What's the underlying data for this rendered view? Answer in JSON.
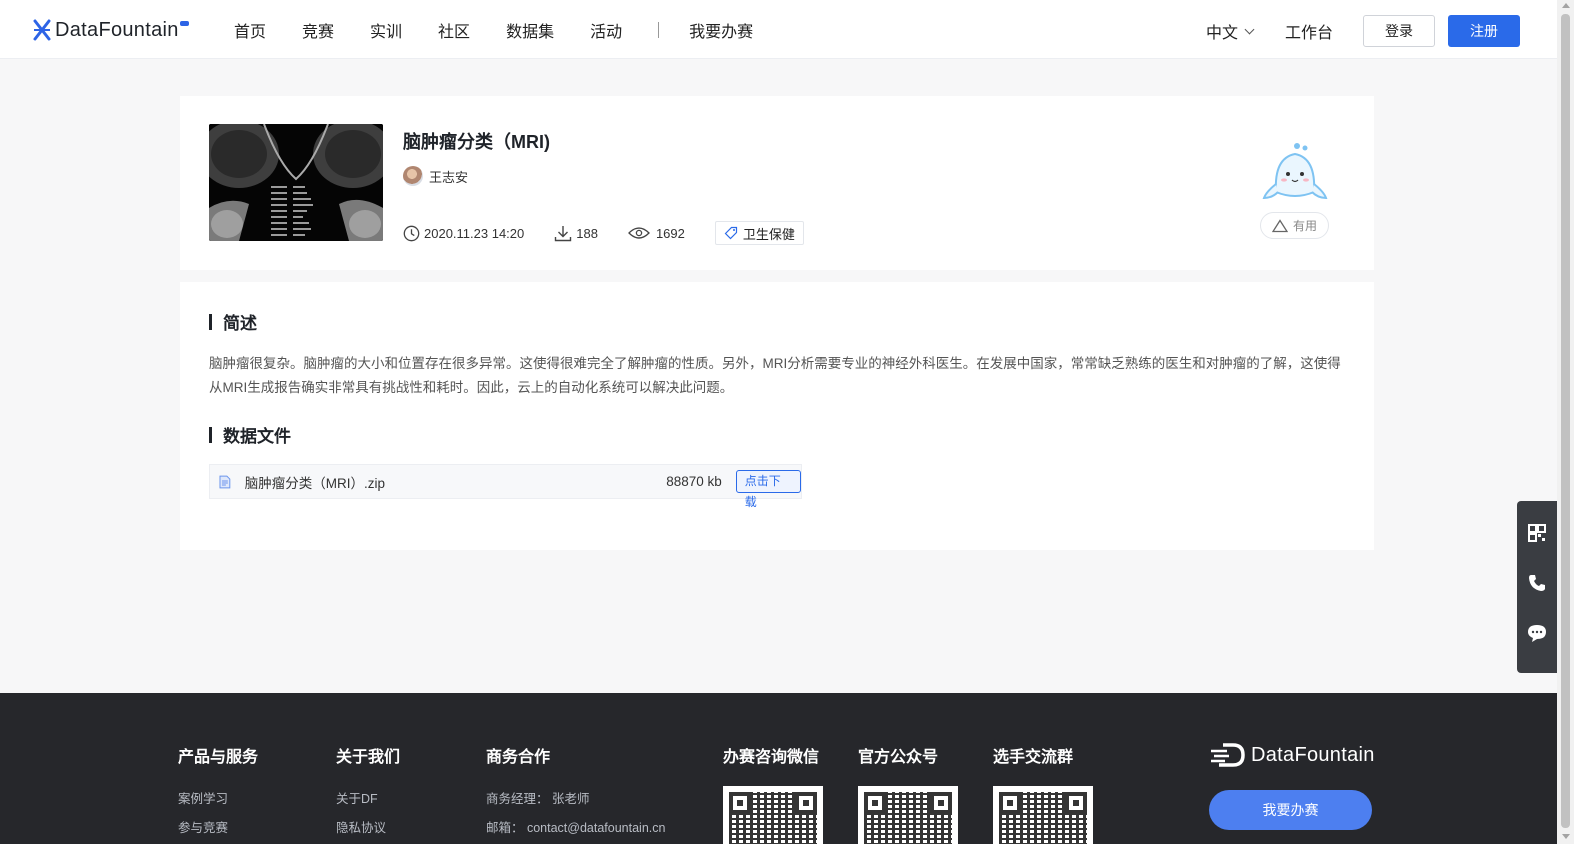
{
  "header": {
    "logo_text": "DataFountain",
    "nav": [
      "首页",
      "竞赛",
      "实训",
      "社区",
      "数据集",
      "活动"
    ],
    "nav_extra": "我要办赛",
    "language": "中文",
    "workbench": "工作台",
    "login": "登录",
    "register": "注册"
  },
  "dataset": {
    "title": "脑肿瘤分类（MRI)",
    "author": "王志安",
    "datetime": "2020.11.23 14:20",
    "downloads": "188",
    "views": "1692",
    "tag": "卫生保健",
    "useful_label": "有用"
  },
  "overview": {
    "title": "简述",
    "text": "脑肿瘤很复杂。脑肿瘤的大小和位置存在很多异常。这使得很难完全了解肿瘤的性质。另外，MRI分析需要专业的神经外科医生。在发展中国家，常常缺乏熟练的医生和对肿瘤的了解，这使得从MRI生成报告确实非常具有挑战性和耗时。因此，云上的自动化系统可以解决此问题。"
  },
  "files": {
    "title": "数据文件",
    "items": [
      {
        "name": "脑肿瘤分类（MRI）.zip",
        "size": "88870 kb",
        "action": "点击下载"
      }
    ]
  },
  "footer": {
    "products": {
      "title": "产品与服务",
      "links": [
        "案例学习",
        "参与竞赛"
      ]
    },
    "about": {
      "title": "关于我们",
      "links": [
        "关于DF",
        "隐私协议"
      ]
    },
    "business": {
      "title": "商务合作",
      "manager": "商务经理： 张老师",
      "email": "邮箱： contact@datafountain.cn"
    },
    "qr_wechat": "办赛咨询微信",
    "qr_official": "官方公众号",
    "qr_group": "选手交流群",
    "logo_text": "DataFountain",
    "cta": "我要办赛"
  },
  "colors": {
    "brand_blue": "#2a6ae9",
    "footer_bg": "#26272b",
    "page_bg": "#f7f7f8"
  }
}
